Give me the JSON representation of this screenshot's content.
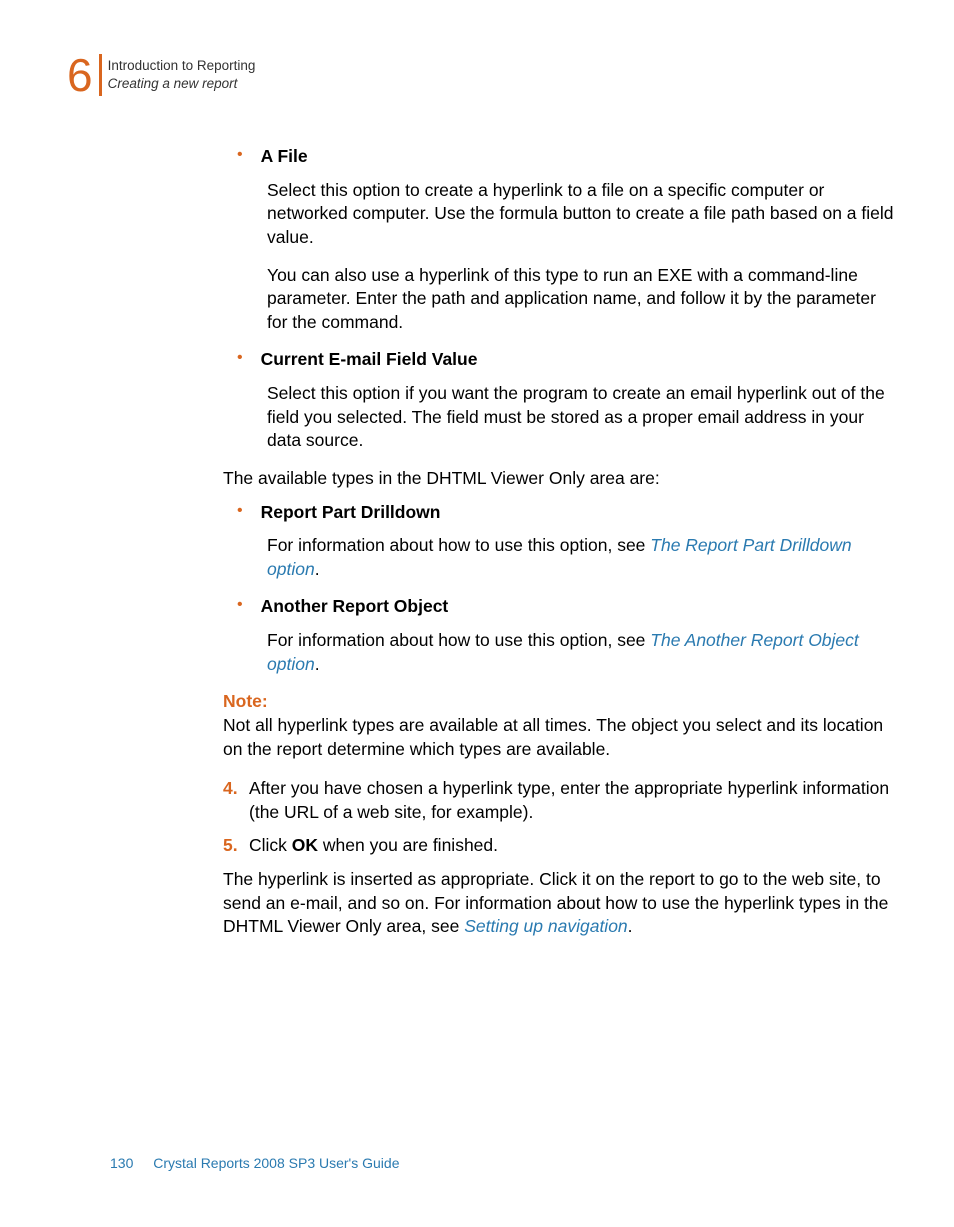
{
  "header": {
    "chapter_num": "6",
    "line1": "Introduction to Reporting",
    "line2": "Creating a new report"
  },
  "bullets": {
    "b1": {
      "title": "A File",
      "p1": "Select this option to create a hyperlink to a file on a specific computer or networked computer. Use the formula button to create a file path based on a field value.",
      "p2": "You can also use a hyperlink of this type to run an EXE with a command-line parameter. Enter the path and application name, and follow it by the parameter for the command."
    },
    "b2": {
      "title": "Current E-mail Field Value",
      "p1": "Select this option if you want the program to create an email hyperlink out of the field you selected. The field must be stored as a proper email address in your data source."
    },
    "intro2": "The available types in the DHTML Viewer Only area are:",
    "b3": {
      "title": "Report Part Drilldown",
      "p1_pre": "For information about how to use this option, see ",
      "p1_link": "The Report Part Drilldown option",
      "p1_post": "."
    },
    "b4": {
      "title": "Another Report Object",
      "p1_pre": "For information about how to use this option, see ",
      "p1_link": "The Another Report Object option",
      "p1_post": "."
    }
  },
  "note": {
    "label": "Note:",
    "text": "Not all hyperlink types are available at all times. The object you select and its location on the report determine which types are available."
  },
  "steps": {
    "s4": {
      "num": "4.",
      "text": "After you have chosen a hyperlink type, enter the appropriate hyperlink information (the URL of a web site, for example)."
    },
    "s5": {
      "num": "5.",
      "pre": "Click ",
      "bold": "OK",
      "post": " when you are finished."
    }
  },
  "final": {
    "pre": "The hyperlink is inserted as appropriate. Click it on the report to go to the web site, to send an e-mail, and so on. For information about how to use the hyperlink types in the DHTML Viewer Only area, see ",
    "link": "Setting up navigation",
    "post": "."
  },
  "footer": {
    "page": "130",
    "title": "Crystal Reports 2008 SP3 User's Guide"
  }
}
